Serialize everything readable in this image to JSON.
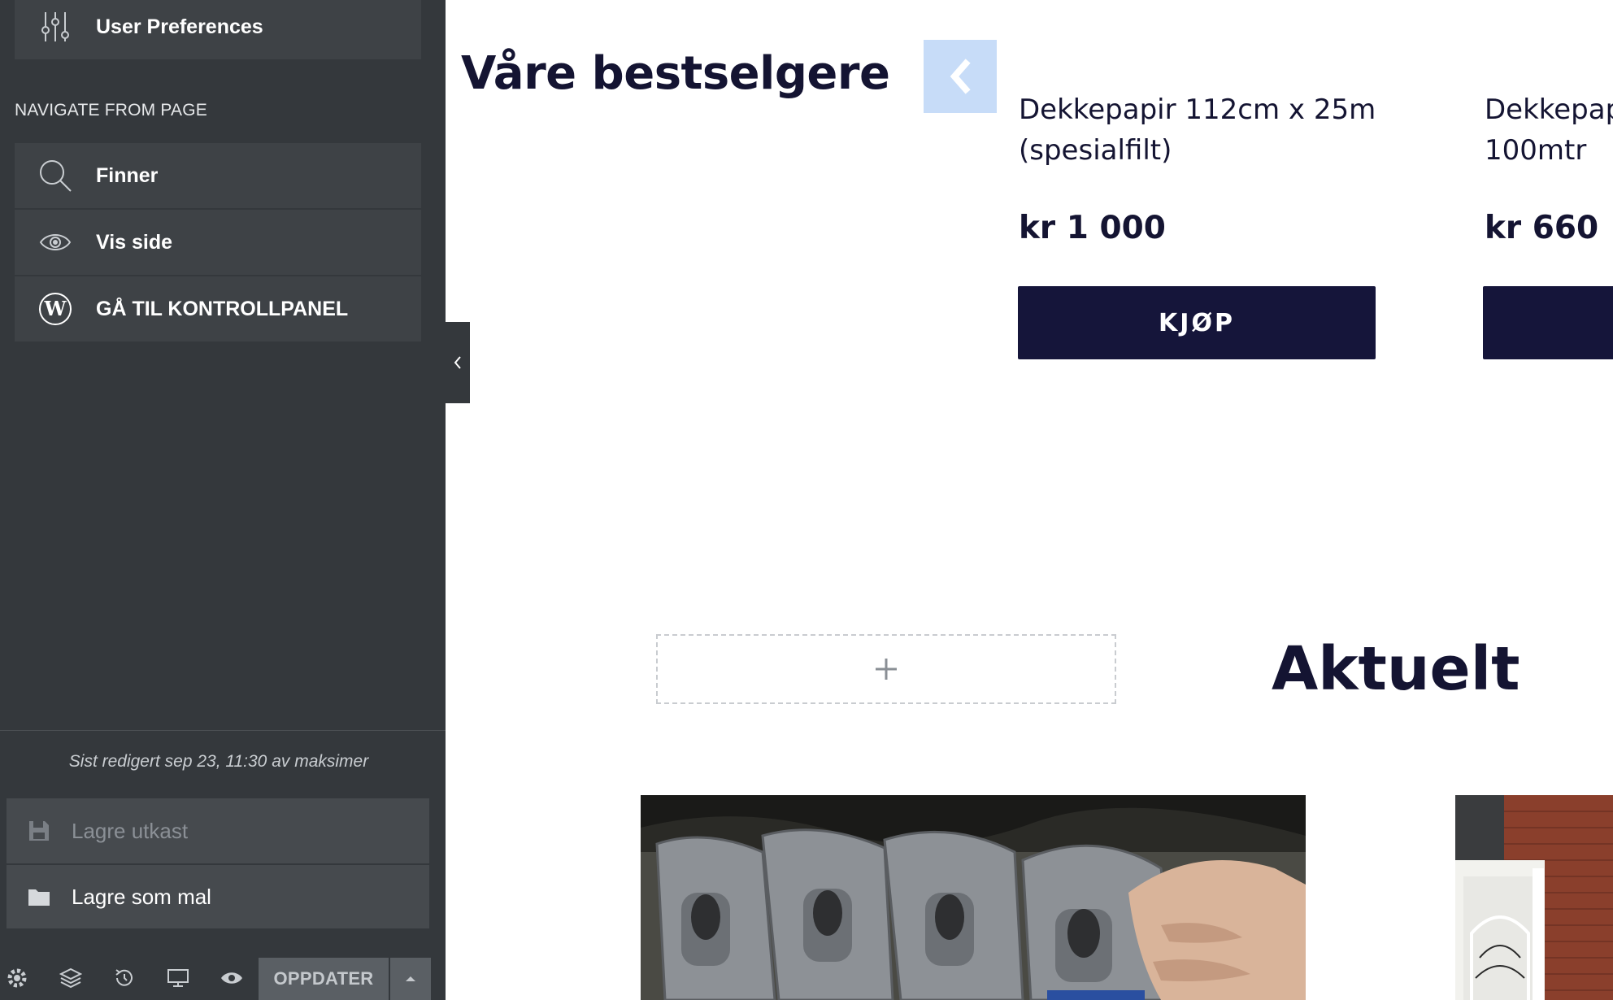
{
  "sidebar": {
    "user_preferences": {
      "label": "User Preferences",
      "icon": "sliders-icon"
    },
    "section_title": "NAVIGATE FROM PAGE",
    "nav_items": [
      {
        "label": "Finner",
        "icon": "search-icon"
      },
      {
        "label": "Vis side",
        "icon": "eye-icon"
      },
      {
        "label": "GÅ TIL KONTROLLPANEL",
        "icon": "wordpress-icon"
      }
    ],
    "last_edited": "Sist redigert sep 23, 11:30 av maksimer",
    "save_draft": {
      "label": "Lagre utkast",
      "icon": "floppy-disk-icon"
    },
    "save_template": {
      "label": "Lagre som mal",
      "icon": "folder-icon"
    },
    "bottom_bar": {
      "icons": [
        "gear-icon",
        "layers-icon",
        "history-icon",
        "desktop-icon",
        "eye-icon"
      ],
      "update_label": "OPPDATER"
    }
  },
  "main": {
    "bestsellers_heading": "Våre bestselgere",
    "products": [
      {
        "name_line1": "Dekkepapir 112cm x 25m",
        "name_line2": "(spesialfilt)",
        "price": "kr 1 000",
        "buy_label": "KJØP"
      },
      {
        "name_line1": "Dekkepap",
        "name_line2": "100mtr",
        "price": "kr 660",
        "buy_label": ""
      }
    ],
    "add_widget_symbol": "+",
    "aktuelt_heading": "Aktuelt"
  },
  "colors": {
    "sidebar_bg": "#34383c",
    "menu_item_bg": "#3e4246",
    "heading_text": "#141432",
    "buy_button_bg": "#15153a",
    "carousel_prev_bg": "#c7dcf8"
  }
}
